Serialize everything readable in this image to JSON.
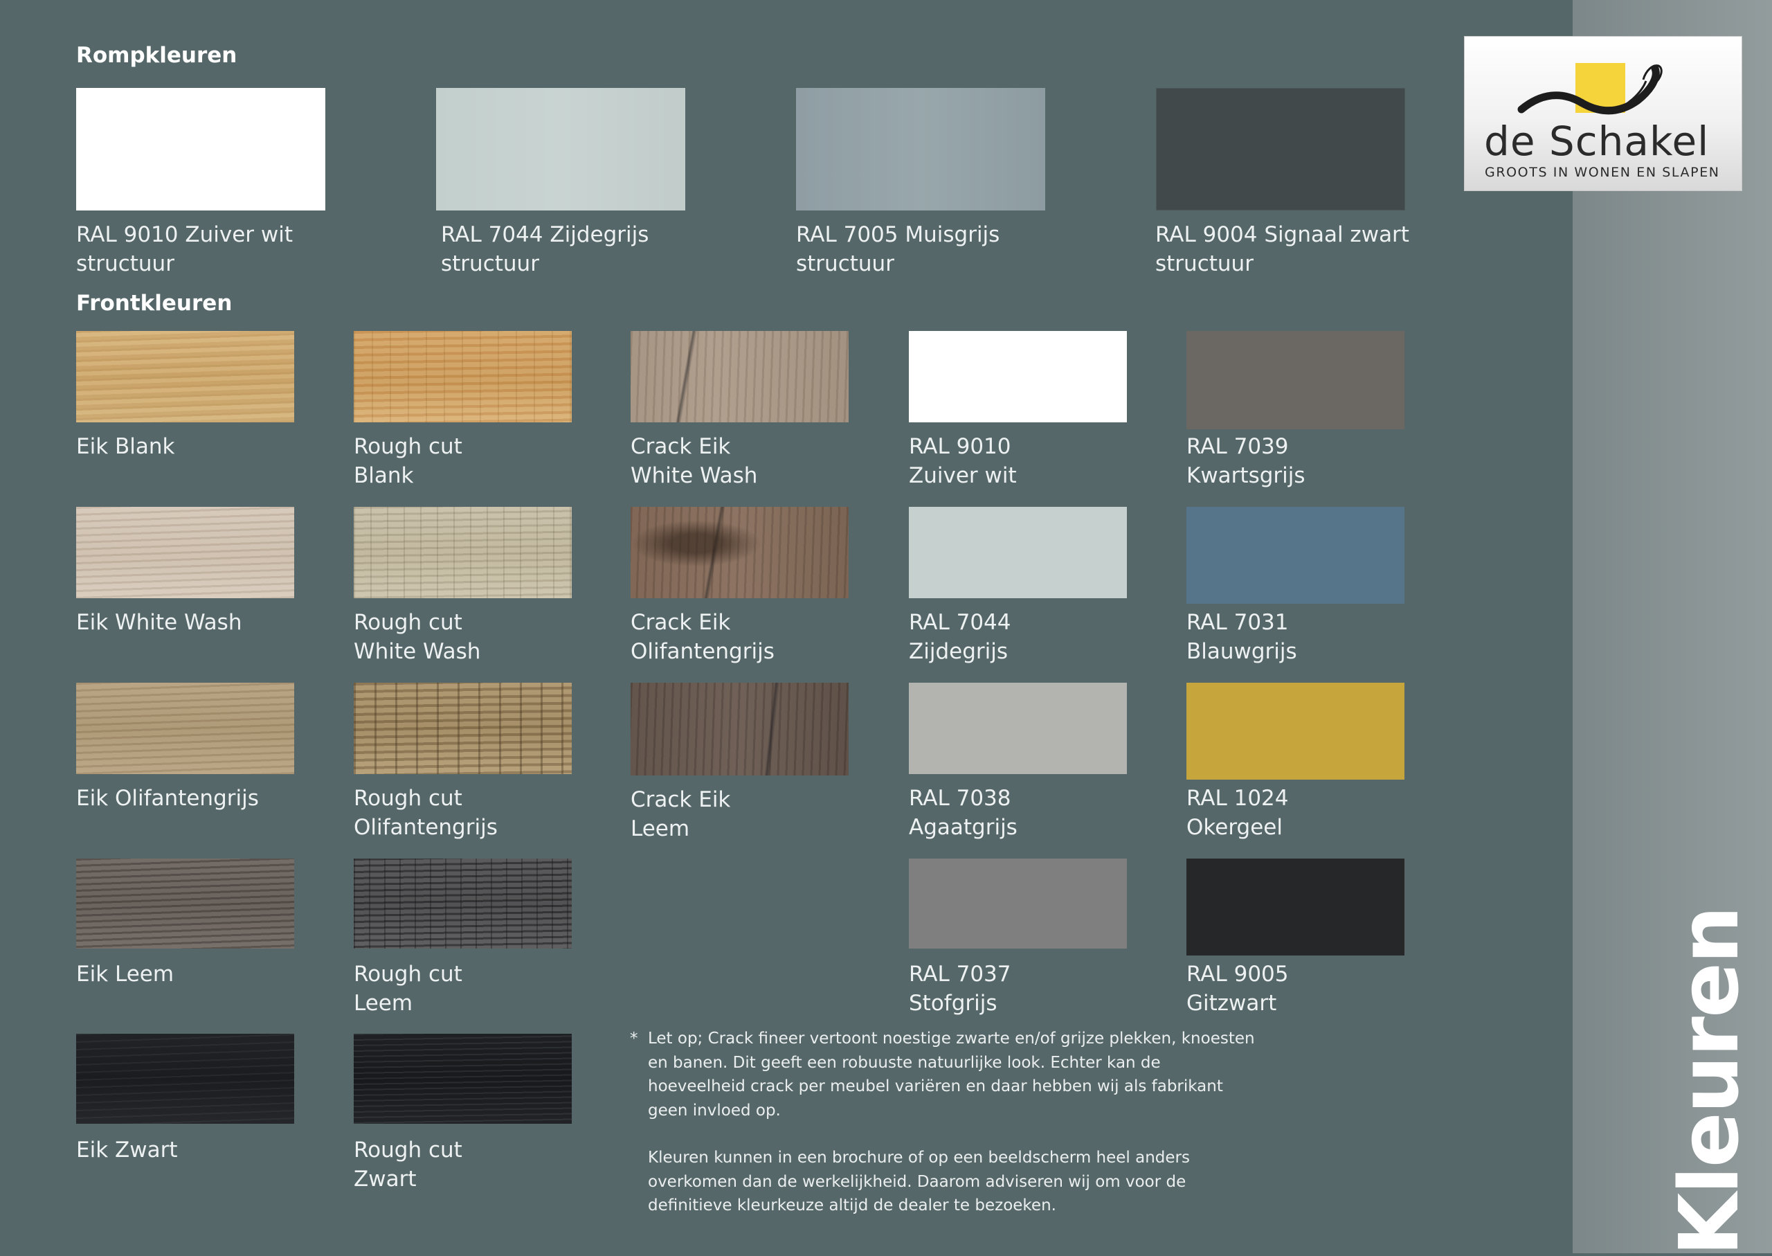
{
  "brand": {
    "name": "de Schakel",
    "tagline": "GROOTS IN WONEN EN SLAPEN",
    "accent": "#f5d33a"
  },
  "side_title": "Kleuren",
  "body_colors": {
    "heading": "Rompkleuren",
    "items": [
      {
        "line1": "RAL 9010 Zuiver wit",
        "line2": "structuur",
        "color": "#ffffff"
      },
      {
        "line1": "RAL 7044 Zijdegrijs",
        "line2": "structuur",
        "color": "#c6d1cf"
      },
      {
        "line1": "RAL 7005 Muisgrijs",
        "line2": "structuur",
        "color": "#95a4a9"
      },
      {
        "line1": "RAL 9004 Signaal zwart",
        "line2": "structuur",
        "color": "#42494b"
      }
    ]
  },
  "front_colors": {
    "heading": "Frontkleuren",
    "items": [
      {
        "line1": "Eik Blank",
        "line2": ""
      },
      {
        "line1": "Rough cut",
        "line2": "Blank"
      },
      {
        "line1": "Crack Eik",
        "line2": "White Wash"
      },
      {
        "line1": "RAL 9010",
        "line2": "Zuiver wit",
        "color": "#ffffff"
      },
      {
        "line1": "RAL 7039",
        "line2": "Kwartsgrijs",
        "color": "#6b6864"
      },
      {
        "line1": "Eik White Wash",
        "line2": ""
      },
      {
        "line1": "Rough cut",
        "line2": "White Wash"
      },
      {
        "line1": "Crack Eik",
        "line2": "Olifantengrijs"
      },
      {
        "line1": "RAL 7044",
        "line2": "Zijdegrijs",
        "color": "#c6d0ce"
      },
      {
        "line1": "RAL 7031",
        "line2": "Blauwgrijs",
        "color": "#56748a"
      },
      {
        "line1": "Eik Olifantengrijs",
        "line2": ""
      },
      {
        "line1": "Rough cut",
        "line2": "Olifantengrijs"
      },
      {
        "line1": "Crack Eik",
        "line2": "Leem"
      },
      {
        "line1": "RAL 7038",
        "line2": "Agaatgrijs",
        "color": "#b3b4b0"
      },
      {
        "line1": "RAL 1024",
        "line2": "Okergeel",
        "color": "#c5a53c"
      },
      {
        "line1": "Eik Leem",
        "line2": ""
      },
      {
        "line1": "Rough cut",
        "line2": "Leem"
      },
      {
        "line1": "RAL 7037",
        "line2": "Stofgrijs",
        "color": "#7f7f7f"
      },
      {
        "line1": "RAL 9005",
        "line2": "Gitzwart",
        "color": "#252729"
      },
      {
        "line1": "Eik Zwart",
        "line2": ""
      },
      {
        "line1": "Rough cut",
        "line2": "Zwart"
      }
    ]
  },
  "note": {
    "marker": "*",
    "paragraph1": "Let op; Crack fineer vertoont noestige zwarte en/of grijze plekken, knoesten en banen. Dit geeft een robuuste natuurlijke look. Echter kan de hoeveelheid crack per meubel variëren en daar hebben wij als fabrikant geen invloed op.",
    "paragraph2": "Kleuren kunnen in een brochure of op een beeldscherm heel anders overkomen dan de werkelijkheid. Daarom adviseren wij om voor de definitieve kleurkeuze altijd de dealer te bezoeken."
  }
}
